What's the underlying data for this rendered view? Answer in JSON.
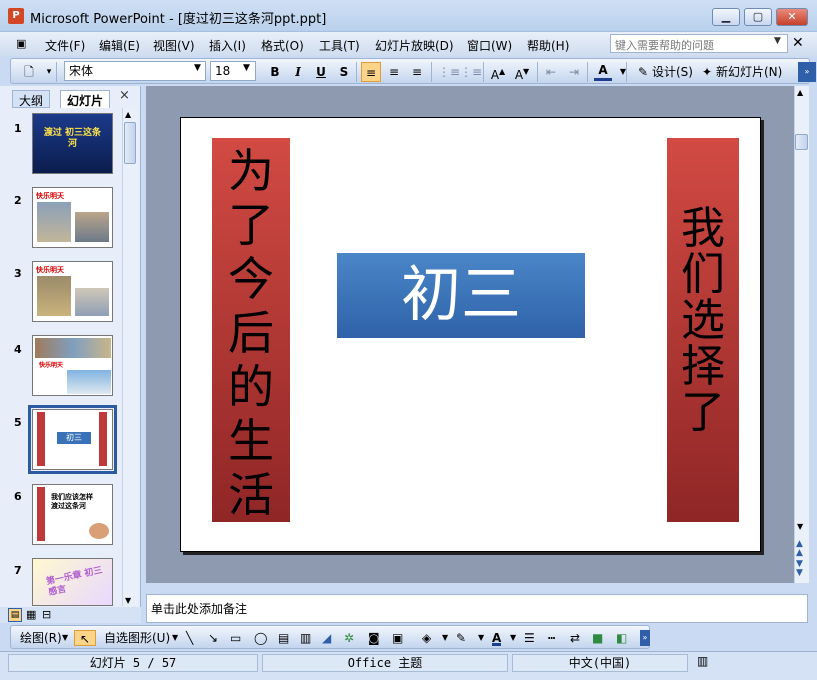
{
  "window": {
    "title": "Microsoft PowerPoint - [度过初三这条河ppt.ppt]",
    "app_icon": "P"
  },
  "menu": {
    "items": [
      "文件(F)",
      "编辑(E)",
      "视图(V)",
      "插入(I)",
      "格式(O)",
      "工具(T)",
      "幻灯片放映(D)",
      "窗口(W)",
      "帮助(H)"
    ],
    "help_placeholder": "键入需要帮助的问题"
  },
  "toolbar": {
    "font_name": "宋体",
    "font_size": "18",
    "bold": "B",
    "italic": "I",
    "underline": "U",
    "shadow": "S",
    "design_label": "设计(S)",
    "new_slide_label": "新幻灯片(N)"
  },
  "panel": {
    "tab_outline": "大纲",
    "tab_slides": "幻灯片",
    "close": "×"
  },
  "thumbnails": [
    {
      "num": "1",
      "text": "渡过 初三这条河"
    },
    {
      "num": "2",
      "text": "快乐明天"
    },
    {
      "num": "3",
      "text": "快乐明天"
    },
    {
      "num": "4",
      "text": "快乐明天"
    },
    {
      "num": "5",
      "text": "初三"
    },
    {
      "num": "6",
      "text": "我们应该怎样渡过这条河"
    },
    {
      "num": "7",
      "text": "第一乐章 初三感言"
    }
  ],
  "slide": {
    "left_text": "为了今后的生活",
    "center_text": "初三",
    "right_text": "我们选择了"
  },
  "notes": {
    "placeholder": "单击此处添加备注"
  },
  "drawbar": {
    "draw_label": "绘图(R)",
    "autoshape_label": "自选图形(U)"
  },
  "status": {
    "slide_info": "幻灯片 5 / 57",
    "theme": "Office 主题",
    "language": "中文(中国)"
  },
  "colors": {
    "accent_red": "#d24a43",
    "accent_blue": "#3a72b8",
    "selection": "#2c5aa0"
  }
}
